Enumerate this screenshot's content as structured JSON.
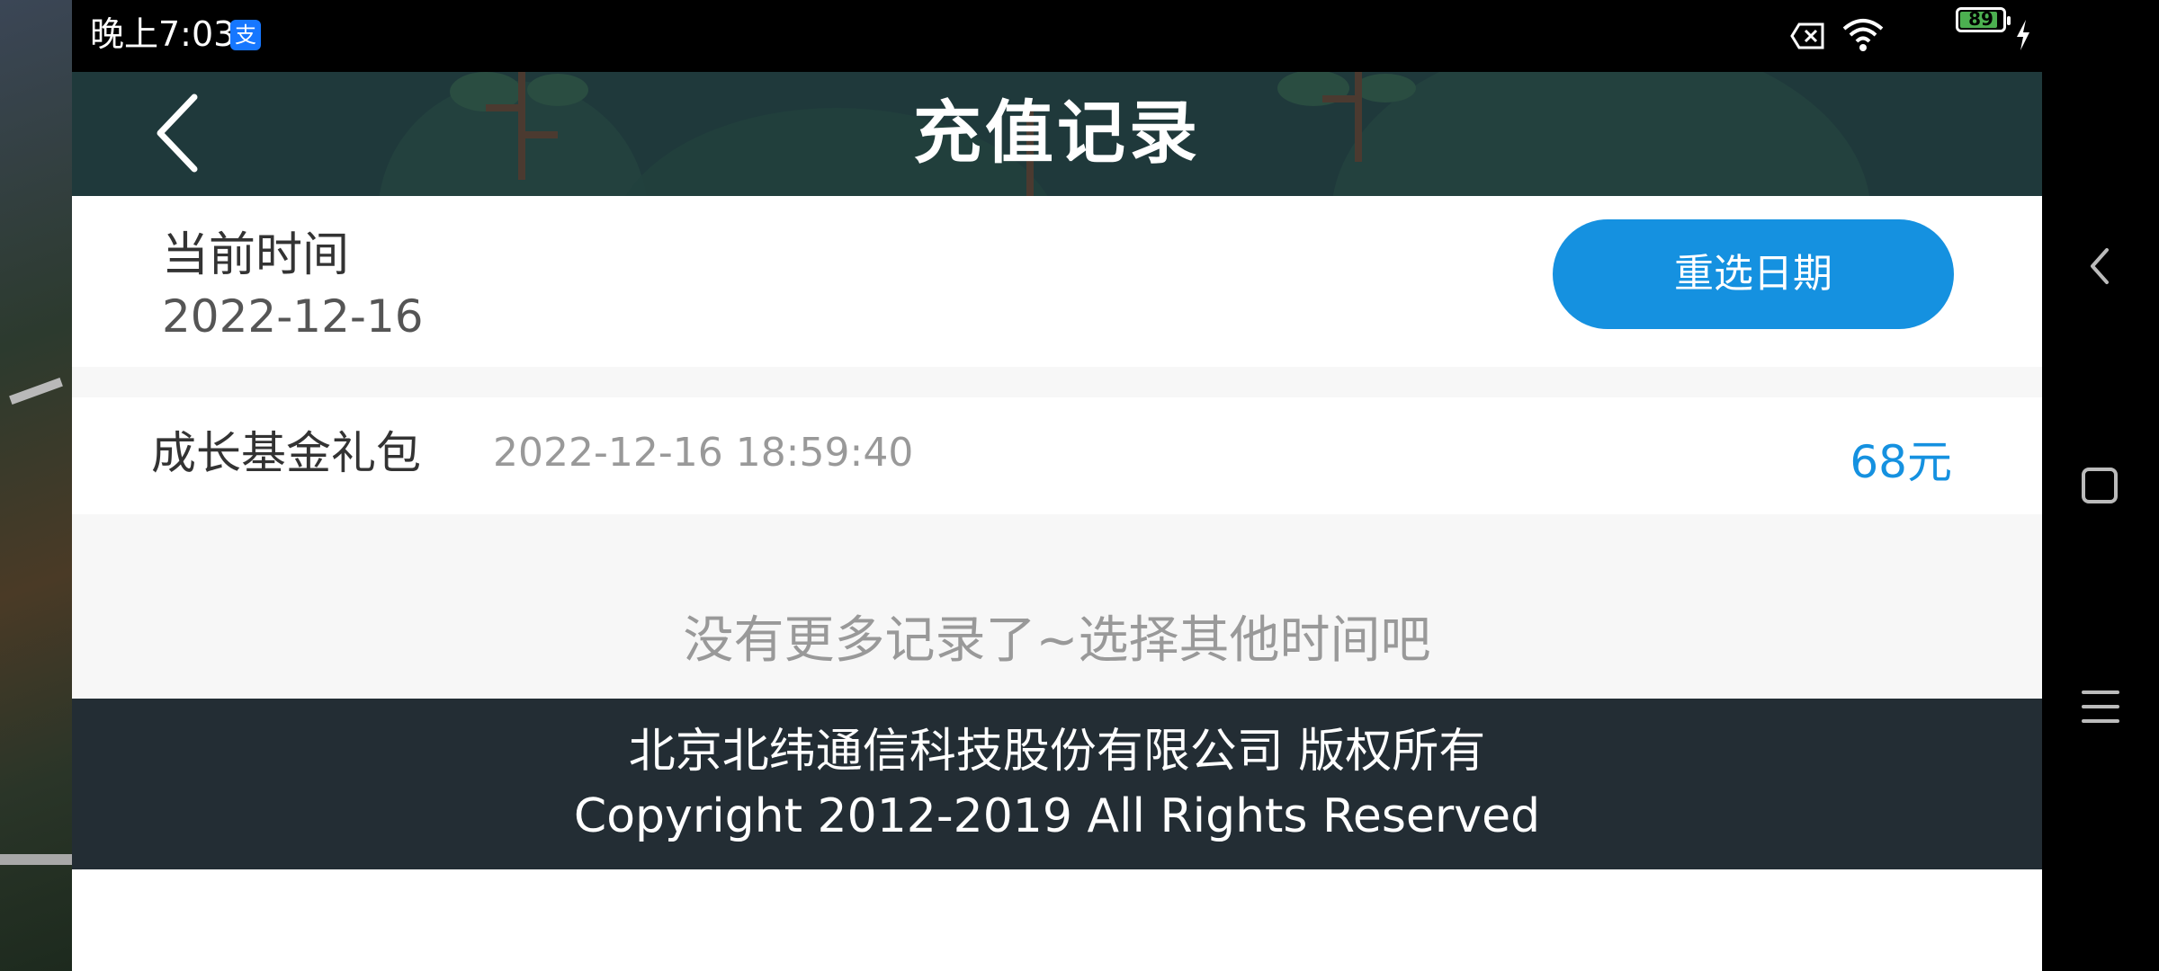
{
  "status_bar": {
    "time": "晚上7:03",
    "app_badge": "支",
    "battery_level": "89",
    "battery_fraction": 0.89
  },
  "header": {
    "title": "充值记录",
    "back_icon": "chevron-left-icon"
  },
  "date_panel": {
    "label": "当前时间",
    "date": "2022-12-16",
    "reselect_label": "重选日期"
  },
  "records": [
    {
      "name": "成长基金礼包",
      "time": "2022-12-16 18:59:40",
      "amount": "68元"
    }
  ],
  "empty_hint": "没有更多记录了~选择其他时间吧",
  "footer": {
    "line1": "北京北纬通信科技股份有限公司 版权所有",
    "line2": "Copyright 2012-2019 All Rights Reserved"
  },
  "colors": {
    "accent": "#1591e0",
    "header_bg": "#1f393b",
    "footer_bg": "#232d34"
  }
}
